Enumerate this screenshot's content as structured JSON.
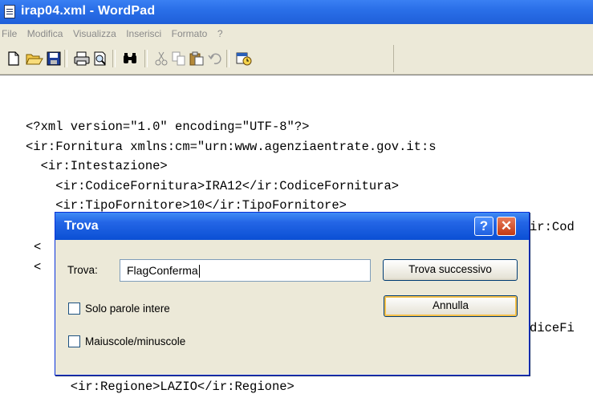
{
  "window": {
    "title": "irap04.xml - WordPad"
  },
  "menu": [
    "File",
    "Modifica",
    "Visualizza",
    "Inserisci",
    "Formato",
    "?"
  ],
  "toolbar": {
    "icons": [
      "new-icon",
      "open-icon",
      "save-icon",
      "print-icon",
      "print-preview-icon",
      "find-icon",
      "cut-icon",
      "copy-icon",
      "paste-icon",
      "undo-icon",
      "insert-date-icon"
    ]
  },
  "document": {
    "lines": [
      "<?xml version=\"1.0\" encoding=\"UTF-8\"?>",
      "<ir:Fornitura xmlns:cm=\"urn:www.agenziaentrate.gov.it:s",
      "  <ir:Intestazione>",
      "    <ir:CodiceFornitura>IRA12</ir:CodiceFornitura>",
      "    <ir:TipoFornitore>10</ir:TipoFornitore>",
      "ir:Cod",
      "<",
      "<",
      "diceFi",
      "      <ir:Regione>LAZIO</ir:Regione>"
    ]
  },
  "dialog": {
    "title": "Trova",
    "help_label": "?",
    "close_label": "✕",
    "find_label": "Trova:",
    "find_value": "FlagConferma",
    "find_next_label": "Trova successivo",
    "cancel_label": "Annulla",
    "whole_words_label": "Solo parole intere",
    "whole_words_checked": false,
    "match_case_label": "Maiuscole/minuscole",
    "match_case_checked": false
  }
}
